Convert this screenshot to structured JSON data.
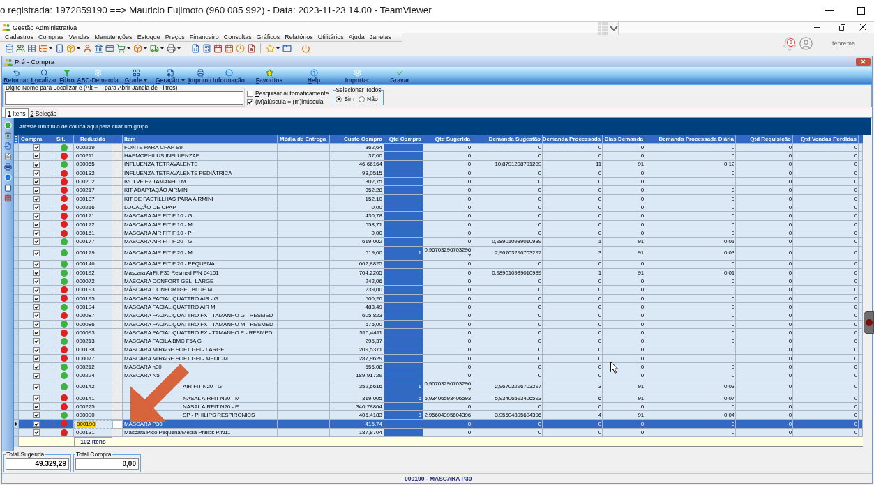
{
  "remote_session": {
    "title": "o registrada: 1972859190 ==> Mauricio Fujimoto (960 085 992) - Data: 2023-11-23 14.00 - TeamViewer"
  },
  "app": {
    "title": "Gestão Administrativa",
    "menu": [
      "Cadastros",
      "Compras",
      "Vendas",
      "Manutenções",
      "Estoque",
      "Preços",
      "Financeiro",
      "Consultas",
      "Gráficos",
      "Relatórios",
      "Utilitários",
      "Ajuda",
      "Janelas"
    ],
    "notifications": "0",
    "user": "teorema"
  },
  "window": {
    "title": "Pré - Compra",
    "toolbar": [
      {
        "label": "Retornar",
        "hotkey": true,
        "menu": false
      },
      {
        "label": "Localizar",
        "hotkey": true,
        "menu": false
      },
      {
        "label": "Filtro",
        "hotkey": true,
        "menu": false
      },
      {
        "label": "ABC-Demanda",
        "hotkey": true,
        "menu": false
      },
      {
        "label": "Grade",
        "hotkey": true,
        "menu": true
      },
      {
        "label": "Geração",
        "hotkey": true,
        "menu": true
      },
      {
        "label": "Imprimir",
        "hotkey": true,
        "menu": false
      },
      {
        "label": "Informação",
        "hotkey": false,
        "menu": false
      },
      {
        "label": "Favoritos",
        "hotkey": true,
        "menu": false
      },
      {
        "label": "Help",
        "hotkey": true,
        "menu": false
      },
      {
        "label": "Importar",
        "hotkey": false,
        "menu": false
      },
      {
        "label": "Gravar",
        "hotkey": false,
        "menu": false
      }
    ]
  },
  "search": {
    "label": "Digite Nome para Localizar e (Alt + F para Abrir Janela de Filtros)",
    "hotkey": true,
    "options": [
      {
        "label": "Pesquisar automaticamente",
        "checked": false,
        "hotkey": true
      },
      {
        "label": "(M)aiúscula = (m)inúscula",
        "checked": true,
        "hotkey": false
      }
    ],
    "select_all": {
      "label": "Selecionar Todos",
      "options": [
        {
          "label": "Sim",
          "selected": true
        },
        {
          "label": "Não",
          "selected": false
        }
      ]
    }
  },
  "tabs": [
    {
      "label": "1 Itens",
      "selected": true,
      "hotkey": true
    },
    {
      "label": "2 Seleção",
      "selected": false,
      "hotkey": true
    }
  ],
  "grid": {
    "group_hint": "Arraste um título de coluna aqui para criar um grupo",
    "columns": [
      "Compra",
      "Sit.",
      "Reduzido",
      "Item",
      "Média de Entrega",
      "Custo Compra",
      "Qtd Compra",
      "Qtd Sugerida",
      "Demanda Sugestão",
      "Demanda Processada",
      "Dias Demanda",
      "Demanda Processada Diária",
      "Qtd Requisição",
      "Qtd Vendas Perdidas"
    ],
    "rows": [
      {
        "checked": true,
        "color": "#3cb43c",
        "code": "000219",
        "item": "FONTE PARA CPAP S9",
        "cost": "362,64",
        "values": [
          "0",
          "0",
          "0",
          "0",
          "0",
          "0",
          "0"
        ],
        "selected": false,
        "behind_arrow": false
      },
      {
        "checked": true,
        "color": "#e21e1e",
        "code": "000211",
        "item": "HAEMOPHILUS INFLUENZAE",
        "cost": "37,00",
        "values": [
          "0",
          "0",
          "0",
          "0",
          "0",
          "0",
          "0"
        ],
        "selected": false,
        "behind_arrow": false
      },
      {
        "checked": true,
        "color": "#3cb43c",
        "code": "000065",
        "item": "INFLUENZA TETRAVALENTE",
        "cost": "46,66164",
        "values": [
          "0",
          "10,8791208791209",
          "11",
          "91",
          "0,12",
          "0",
          "0"
        ],
        "selected": false,
        "behind_arrow": false
      },
      {
        "checked": true,
        "color": "#e21e1e",
        "code": "000132",
        "item": "INFLUENZA TETRAVALENTE PEDIÁTRICA",
        "cost": "93,0515",
        "values": [
          "0",
          "0",
          "0",
          "0",
          "0",
          "0",
          "0"
        ],
        "selected": false,
        "behind_arrow": false
      },
      {
        "checked": true,
        "color": "#e21e1e",
        "code": "000202",
        "item": "IVOLVE F2 TAMANHO M",
        "cost": "302,75",
        "values": [
          "0",
          "0",
          "0",
          "0",
          "0",
          "0",
          "0"
        ],
        "selected": false,
        "behind_arrow": false
      },
      {
        "checked": true,
        "color": "#e21e1e",
        "code": "000217",
        "item": "KIT ADAPTAÇÃO AIRMINI",
        "cost": "352,28",
        "values": [
          "0",
          "0",
          "0",
          "0",
          "0",
          "0",
          "0"
        ],
        "selected": false,
        "behind_arrow": false
      },
      {
        "checked": true,
        "color": "#e21e1e",
        "code": "000187",
        "item": "KIT DE PASTILLHAS PARA AIRMINI",
        "cost": "152,10",
        "values": [
          "0",
          "0",
          "0",
          "0",
          "0",
          "0",
          "0"
        ],
        "selected": false,
        "behind_arrow": false
      },
      {
        "checked": true,
        "color": "#e21e1e",
        "code": "000216",
        "item": "LOCAÇÃO DE CPAP",
        "cost": "0,00",
        "values": [
          "0",
          "0",
          "0",
          "0",
          "0",
          "0",
          "0"
        ],
        "selected": false,
        "behind_arrow": false
      },
      {
        "checked": true,
        "color": "#e21e1e",
        "code": "000171",
        "item": "MASCARA AIR FIT F 10 - G",
        "cost": "430,78",
        "values": [
          "0",
          "0",
          "0",
          "0",
          "0",
          "0",
          "0"
        ],
        "selected": false,
        "behind_arrow": false
      },
      {
        "checked": true,
        "color": "#e21e1e",
        "code": "000172",
        "item": "MASCARA AIR FIT F 10 - M",
        "cost": "658,71",
        "values": [
          "0",
          "0",
          "0",
          "0",
          "0",
          "0",
          "0"
        ],
        "selected": false,
        "behind_arrow": false
      },
      {
        "checked": true,
        "color": "#e21e1e",
        "code": "000151",
        "item": "MASCARA AIR FIT F 10 - P",
        "cost": "0,00",
        "values": [
          "0",
          "0",
          "0",
          "0",
          "0",
          "0",
          "0"
        ],
        "selected": false,
        "behind_arrow": false
      },
      {
        "checked": true,
        "color": "#3cb43c",
        "code": "000177",
        "item": "MASCARA AIR FIT F 20 - G",
        "cost": "619,002",
        "values": [
          "0",
          "0,989010989010989",
          "1",
          "91",
          "0,01",
          "0",
          "0"
        ],
        "selected": false,
        "behind_arrow": false
      },
      {
        "checked": true,
        "color": "#3cb43c",
        "code": "000179",
        "item": "MASCARA AIR FIT F 20 - M",
        "cost": "619,00",
        "qty": "1",
        "values": [
          "0,967032967032967",
          "2,96703296703297",
          "3",
          "91",
          "0,03",
          "0",
          "0"
        ],
        "selected": false,
        "behind_arrow": false
      },
      {
        "checked": true,
        "color": "#3cb43c",
        "code": "000146",
        "item": "MASCARA AIR FIT F 20 - PEQUENA",
        "cost": "662,8825",
        "values": [
          "0",
          "0",
          "0",
          "0",
          "0",
          "0",
          "0"
        ],
        "selected": false,
        "behind_arrow": false
      },
      {
        "checked": true,
        "color": "#3cb43c",
        "code": "000192",
        "item": "Mascara AirFit F30 Resmed P/N 64101",
        "cost": "704,2205",
        "values": [
          "0",
          "0,989010989010989",
          "1",
          "91",
          "0,01",
          "0",
          "0"
        ],
        "selected": false,
        "behind_arrow": false
      },
      {
        "checked": true,
        "color": "#3cb43c",
        "code": "000072",
        "item": "MASCARA CONFORT GEL- LARGE",
        "cost": "242,06",
        "values": [
          "0",
          "0",
          "0",
          "0",
          "0",
          "0",
          "0"
        ],
        "selected": false,
        "behind_arrow": false
      },
      {
        "checked": true,
        "color": "#e21e1e",
        "code": "000193",
        "item": "MÁSCARA CONFORTGEL BLUE M",
        "cost": "239,00",
        "values": [
          "0",
          "0",
          "0",
          "0",
          "0",
          "0",
          "0"
        ],
        "selected": false,
        "behind_arrow": false
      },
      {
        "checked": true,
        "color": "#e21e1e",
        "code": "000195",
        "item": "MASCARA FACIAL QUATTRO AIR - G",
        "cost": "500,26",
        "values": [
          "0",
          "0",
          "0",
          "0",
          "0",
          "0",
          "0"
        ],
        "selected": false,
        "behind_arrow": false
      },
      {
        "checked": true,
        "color": "#3cb43c",
        "code": "000194",
        "item": "MASCARA FACIAL QUATTRO AIR M",
        "cost": "483,49",
        "values": [
          "0",
          "0",
          "0",
          "0",
          "0",
          "0",
          "0"
        ],
        "selected": false,
        "behind_arrow": false
      },
      {
        "checked": true,
        "color": "#e21e1e",
        "code": "000087",
        "item": "MASCARA FACIAL QUATTRO FX - TAMANHO G - RESMED",
        "cost": "605,823",
        "values": [
          "0",
          "0",
          "0",
          "0",
          "0",
          "0",
          "0"
        ],
        "selected": false,
        "behind_arrow": false
      },
      {
        "checked": true,
        "color": "#3cb43c",
        "code": "000086",
        "item": "MASCARA FACIAL QUATTRO FX - TAMANHO M - RESMED",
        "cost": "675,00",
        "values": [
          "0",
          "0",
          "0",
          "0",
          "0",
          "0",
          "0"
        ],
        "selected": false,
        "behind_arrow": false
      },
      {
        "checked": true,
        "color": "#e21e1e",
        "code": "000093",
        "item": "MASCARA FACIAL QUATTRO FX - TAMANHO P - RESMED",
        "cost": "515,4411",
        "values": [
          "0",
          "0",
          "0",
          "0",
          "0",
          "0",
          "0"
        ],
        "selected": false,
        "behind_arrow": false
      },
      {
        "checked": true,
        "color": "#3cb43c",
        "code": "000213",
        "item": "MASCARA FACILA BMC F5A G",
        "cost": "295,37",
        "values": [
          "0",
          "0",
          "0",
          "0",
          "0",
          "0",
          "0"
        ],
        "selected": false,
        "behind_arrow": false
      },
      {
        "checked": true,
        "color": "#e21e1e",
        "code": "000138",
        "item": "MASCARA MIRAGE SOFT GEL- LARGE",
        "cost": "209,5371",
        "values": [
          "0",
          "0",
          "0",
          "0",
          "0",
          "0",
          "0"
        ],
        "selected": false,
        "behind_arrow": false
      },
      {
        "checked": true,
        "color": "#e21e1e",
        "code": "000077",
        "item": "MASCARA MIRAGE SOFT GEL- MEDIUM",
        "cost": "287,9629",
        "values": [
          "0",
          "0",
          "0",
          "0",
          "0",
          "0",
          "0"
        ],
        "selected": false,
        "behind_arrow": false
      },
      {
        "checked": true,
        "color": "#3cb43c",
        "code": "000212",
        "item": "MASCARA n30",
        "cost": "556,08",
        "values": [
          "0",
          "0",
          "0",
          "0",
          "0",
          "0",
          "0"
        ],
        "selected": false,
        "behind_arrow": false
      },
      {
        "checked": true,
        "color": "#3cb43c",
        "code": "000224",
        "item": "MASCARA N5",
        "cost": "189,91729",
        "values": [
          "0",
          "0",
          "0",
          "0",
          "0",
          "0",
          "0"
        ],
        "selected": false,
        "behind_arrow": false
      },
      {
        "checked": true,
        "color": "#3cb43c",
        "code": "000142",
        "item": "AIR FIT N20 - G",
        "cost": "352,6616",
        "qty": "1",
        "values": [
          "0,967032967032967",
          "2,96703296703297",
          "3",
          "91",
          "0,03",
          "0",
          "0"
        ],
        "selected": false,
        "behind_arrow": true
      },
      {
        "checked": true,
        "color": "#e21e1e",
        "code": "000141",
        "item": "NASAL AIRFIT N20 - M",
        "cost": "319,005",
        "qty": "6",
        "values": [
          "5,93406593406593",
          "5,93406593406593",
          "6",
          "91",
          "0,07",
          "0",
          "0"
        ],
        "selected": false,
        "behind_arrow": true
      },
      {
        "checked": true,
        "color": "#e21e1e",
        "code": "000225",
        "item": "NASAL AIRFIT N20 - P",
        "cost": "340,78864",
        "values": [
          "0",
          "0",
          "0",
          "0",
          "0",
          "0",
          "0"
        ],
        "selected": false,
        "behind_arrow": true
      },
      {
        "checked": true,
        "color": "#3cb43c",
        "code": "000090",
        "item": "SP - PHILIPS RESPIRONICS",
        "cost": "405,4183",
        "qty": "3",
        "values": [
          "2,95604395604396",
          "3,95604395604396",
          "4",
          "91",
          "0,04",
          "0",
          "0"
        ],
        "selected": false,
        "behind_arrow": true
      },
      {
        "checked": true,
        "color": "#e21e1e",
        "code": "000190",
        "item": "MASCARA P30",
        "cost": "415,74",
        "values": [
          "0",
          "0",
          "0",
          "0",
          "0",
          "0",
          "0"
        ],
        "selected": true,
        "behind_arrow": false
      },
      {
        "checked": true,
        "color": "#e21e1e",
        "code": "000131",
        "item": "Mascara Pico Pequena/Media Philips P/N11",
        "cost": "187,8704",
        "values": [
          "0",
          "0",
          "0",
          "0",
          "0",
          "0",
          "0"
        ],
        "selected": false,
        "behind_arrow": false
      }
    ],
    "footer": "102 Itens"
  },
  "totals": [
    {
      "label": "Total Sugerida",
      "value": "49.329,29"
    },
    {
      "label": "Total Compra",
      "value": "0,00"
    }
  ],
  "status_bar": "000190 - MASCARA P30",
  "annotation": {
    "kind": "arrow"
  }
}
